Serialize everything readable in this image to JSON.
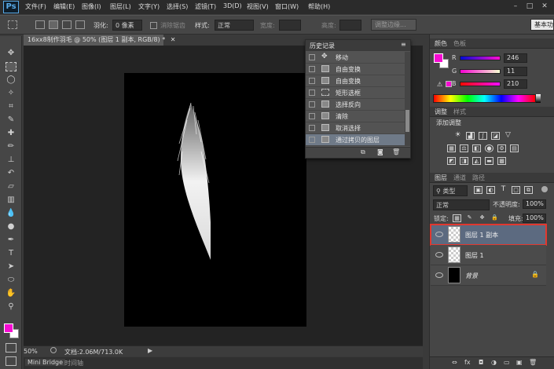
{
  "app": {
    "logo": "Ps"
  },
  "menu": [
    "文件(F)",
    "编辑(E)",
    "图像(I)",
    "图层(L)",
    "文字(Y)",
    "选择(S)",
    "滤镜(T)",
    "3D(D)",
    "视图(V)",
    "窗口(W)",
    "帮助(H)"
  ],
  "window_controls": [
    "–",
    "□",
    "✕"
  ],
  "options": {
    "feather_label": "羽化:",
    "feather_value": "0 像素",
    "antialias_label": "消除锯齿",
    "style_label": "样式:",
    "style_value": "正常",
    "width_label": "宽度:",
    "height_label": "高度:",
    "refine_edge_button": "调整边缘...",
    "workspace_value": "基本功"
  },
  "document": {
    "tab_title": "16xx8制作羽毛 @ 50% (图层 1 副本, RGB/8) *",
    "zoom": "50%",
    "doc_info": "文档:2.06M/713.0K",
    "bottom_tabs": [
      "Mini Bridge",
      "时间轴"
    ]
  },
  "history": {
    "title": "历史记录",
    "items": [
      {
        "label": "移动",
        "selected": false
      },
      {
        "label": "自由变换",
        "selected": false
      },
      {
        "label": "自由变换",
        "selected": false
      },
      {
        "label": "矩形选框",
        "selected": false
      },
      {
        "label": "选择反向",
        "selected": false
      },
      {
        "label": "清除",
        "selected": false
      },
      {
        "label": "取消选择",
        "selected": false
      },
      {
        "label": "通过拷贝的图层",
        "selected": true
      }
    ]
  },
  "color_panel": {
    "tabs": [
      "颜色",
      "色板"
    ],
    "channels": [
      {
        "label": "R",
        "value": "246"
      },
      {
        "label": "G",
        "value": "11"
      },
      {
        "label": "B",
        "value": "210"
      }
    ],
    "foreground_color": "#f60bd2"
  },
  "adjustments_panel": {
    "tabs": [
      "调整",
      "样式"
    ],
    "subtitle": "添加调整"
  },
  "layers_panel": {
    "tabs": [
      "图层",
      "通道",
      "路径"
    ],
    "filter_label": "类型",
    "blend_mode": "正常",
    "opacity_label": "不透明度:",
    "opacity_value": "100%",
    "lock_label": "锁定:",
    "fill_label": "填充:",
    "fill_value": "100%",
    "layers": [
      {
        "name": "图层 1 副本",
        "selected": true,
        "thumb": "checker"
      },
      {
        "name": "图层 1",
        "selected": false,
        "thumb": "checker"
      },
      {
        "name": "背景",
        "selected": false,
        "thumb": "black"
      }
    ]
  },
  "bottom_icons": [
    "⇔",
    "fx",
    "◘",
    "◑",
    "▭",
    "▣",
    "🗑"
  ]
}
